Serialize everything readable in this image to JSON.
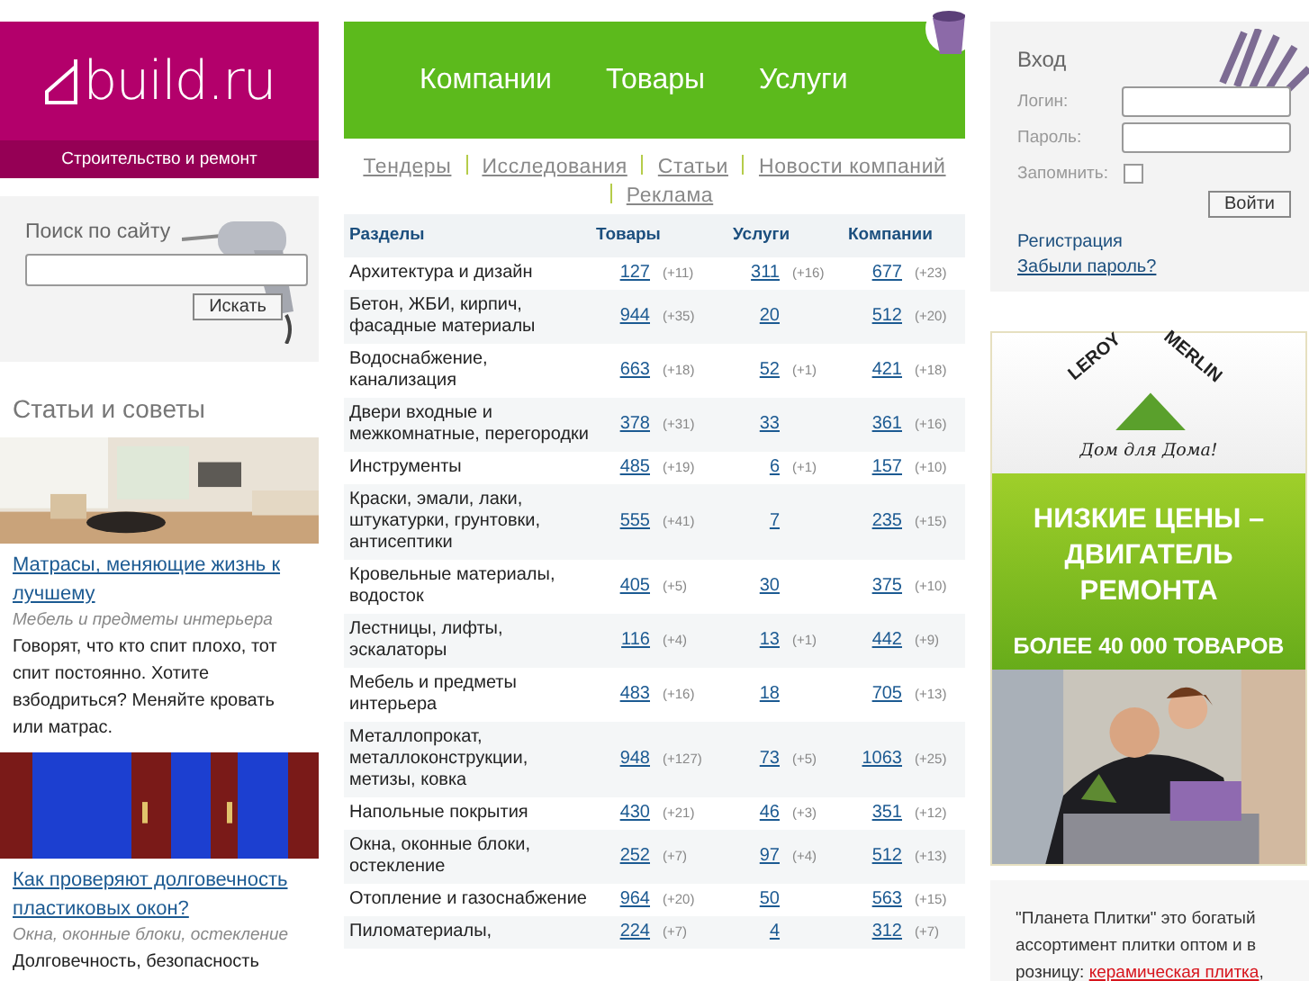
{
  "logo": {
    "text": "build.ru",
    "tagline": "Строительство и ремонт"
  },
  "search": {
    "title": "Поиск по сайту",
    "button": "Искать"
  },
  "articles": {
    "title": "Статьи и советы",
    "items": [
      {
        "kind": "room",
        "title": "Матрасы, меняющие жизнь к лучшему",
        "category": "Мебель и предметы интерьера",
        "text": "Говорят, что кто спит плохо, тот спит постоянно. Хотите взбодриться? Меняйте кровать или матрас."
      },
      {
        "kind": "window",
        "title": "Как проверяют долговечность пластиковых окон?",
        "category": "Окна, оконные блоки, остекление",
        "text": "Долговечность, безопасность"
      }
    ]
  },
  "nav": [
    "Компании",
    "Товары",
    "Услуги"
  ],
  "sublinks": [
    "Тендеры",
    "Исследования",
    "Статьи",
    "Новости компаний",
    "Реклама"
  ],
  "table": {
    "columns": [
      "Разделы",
      "Товары",
      "Услуги",
      "Компании"
    ],
    "rows": [
      {
        "cells": [
          {
            "text": "Архитектура и дизайн"
          },
          {
            "count": "127",
            "delta": "(+11)"
          },
          {
            "count": "311",
            "delta": "(+16)"
          },
          {
            "count": "677",
            "delta": "(+23)"
          }
        ]
      },
      {
        "cells": [
          {
            "text": "Бетон, ЖБИ, кирпич, фасадные материалы"
          },
          {
            "count": "944",
            "delta": "(+35)"
          },
          {
            "count": "20"
          },
          {
            "count": "512",
            "delta": "(+20)"
          }
        ]
      },
      {
        "cells": [
          {
            "text": "Водоснабжение, канализация"
          },
          {
            "count": "663",
            "delta": "(+18)"
          },
          {
            "count": "52",
            "delta": "(+1)"
          },
          {
            "count": "421",
            "delta": "(+18)"
          }
        ]
      },
      {
        "cells": [
          {
            "text": "Двери входные и межкомнатные, перегородки"
          },
          {
            "count": "378",
            "delta": "(+31)"
          },
          {
            "count": "33"
          },
          {
            "count": "361",
            "delta": "(+16)"
          }
        ]
      },
      {
        "cells": [
          {
            "text": "Инструменты"
          },
          {
            "count": "485",
            "delta": "(+19)"
          },
          {
            "count": "6",
            "delta": "(+1)"
          },
          {
            "count": "157",
            "delta": "(+10)"
          }
        ]
      },
      {
        "cells": [
          {
            "text": "Краски, эмали, лаки, штукатурки, грунтовки, антисептики"
          },
          {
            "count": "555",
            "delta": "(+41)"
          },
          {
            "count": "7"
          },
          {
            "count": "235",
            "delta": "(+15)"
          }
        ]
      },
      {
        "cells": [
          {
            "text": "Кровельные материалы, водосток"
          },
          {
            "count": "405",
            "delta": "(+5)"
          },
          {
            "count": "30"
          },
          {
            "count": "375",
            "delta": "(+10)"
          }
        ]
      },
      {
        "cells": [
          {
            "text": "Лестницы, лифты, эскалаторы"
          },
          {
            "count": "116",
            "delta": "(+4)"
          },
          {
            "count": "13",
            "delta": "(+1)"
          },
          {
            "count": "442",
            "delta": "(+9)"
          }
        ]
      },
      {
        "cells": [
          {
            "text": "Мебель и предметы интерьера"
          },
          {
            "count": "483",
            "delta": "(+16)"
          },
          {
            "count": "18"
          },
          {
            "count": "705",
            "delta": "(+13)"
          }
        ]
      },
      {
        "cells": [
          {
            "text": "Металлопрокат, металлоконструкции, метизы, ковка"
          },
          {
            "count": "948",
            "delta": "(+127)"
          },
          {
            "count": "73",
            "delta": "(+5)"
          },
          {
            "count": "1063",
            "delta": "(+25)"
          }
        ]
      },
      {
        "cells": [
          {
            "text": "Напольные покрытия"
          },
          {
            "count": "430",
            "delta": "(+21)"
          },
          {
            "count": "46",
            "delta": "(+3)"
          },
          {
            "count": "351",
            "delta": "(+12)"
          }
        ]
      },
      {
        "cells": [
          {
            "text": "Окна, оконные блоки, остекление"
          },
          {
            "count": "252",
            "delta": "(+7)"
          },
          {
            "count": "97",
            "delta": "(+4)"
          },
          {
            "count": "512",
            "delta": "(+13)"
          }
        ]
      },
      {
        "cells": [
          {
            "text": "Отопление и газоснабжение"
          },
          {
            "count": "964",
            "delta": "(+20)"
          },
          {
            "count": "50"
          },
          {
            "count": "563",
            "delta": "(+15)"
          }
        ]
      },
      {
        "cells": [
          {
            "text": "Пиломатериалы,"
          },
          {
            "count": "224",
            "delta": "(+7)"
          },
          {
            "count": "4"
          },
          {
            "count": "312",
            "delta": "(+7)"
          }
        ]
      }
    ]
  },
  "login": {
    "title": "Вход",
    "fields": [
      {
        "label": "Логин:"
      },
      {
        "label": "Пароль:"
      }
    ],
    "remember": {
      "label": "Запомнить:",
      "checked": false
    },
    "button": "Войти",
    "links": [
      "Регистрация",
      "Забыли пароль?"
    ]
  },
  "banner": {
    "brand_top": "LEROY",
    "brand_bottom": "MERLIN",
    "slogan": "Дом для Дома!",
    "headline": "НИЗКИЕ ЦЕНЫ – ДВИГАТЕЛЬ РЕМОНТА",
    "subline": "БОЛЕЕ 40 000 ТОВАРОВ"
  },
  "promo": {
    "text": "\"Планета Плитки\" это богатый ассортимент плитки оптом и в розницу:",
    "link": "керамическая плитка",
    "after_link": ","
  }
}
